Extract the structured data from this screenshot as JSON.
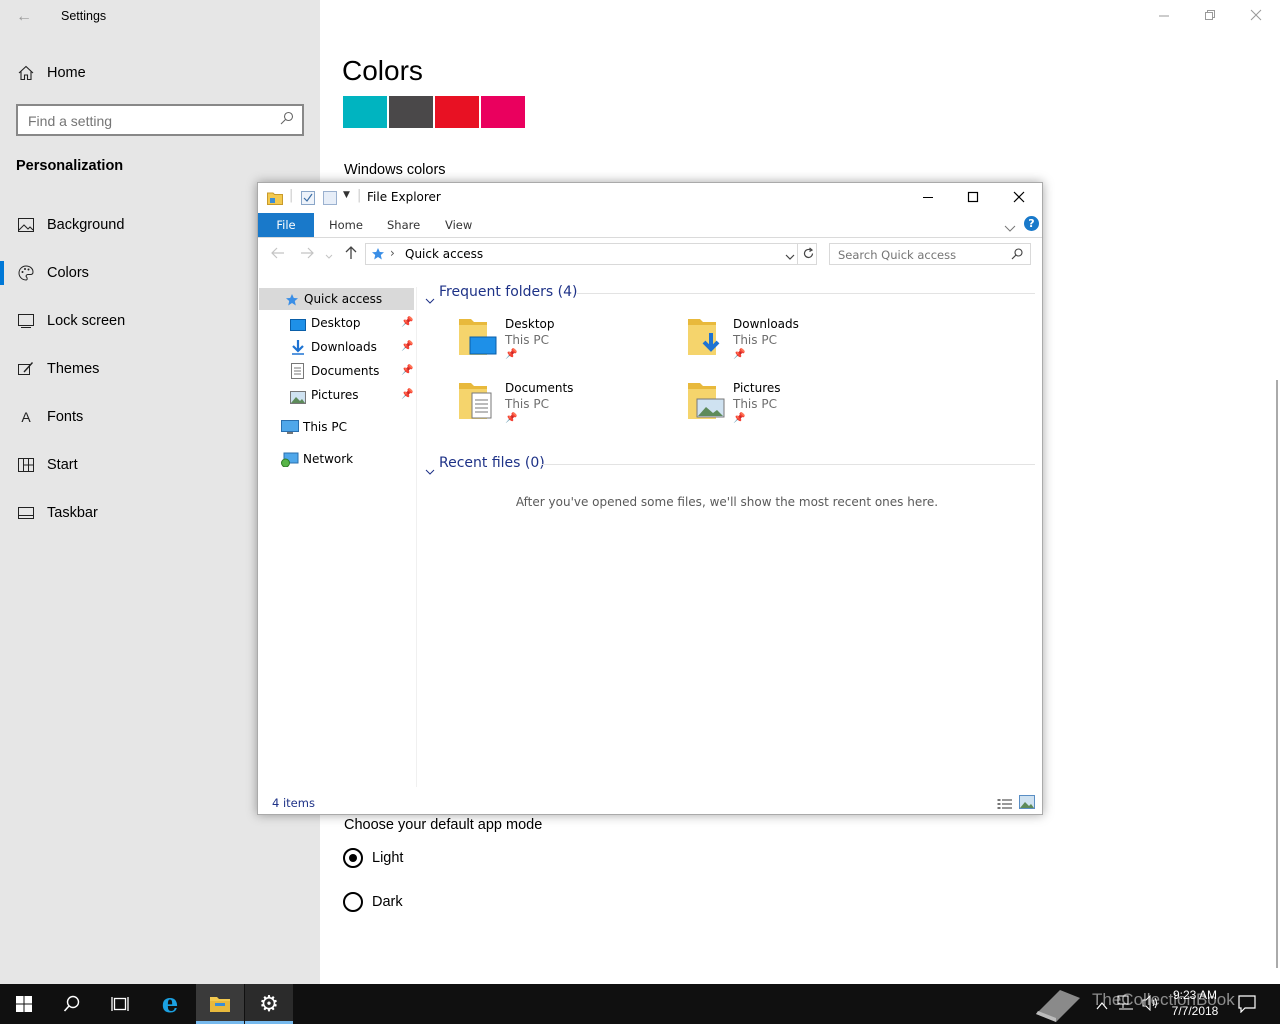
{
  "settings": {
    "window_title": "Settings",
    "home_label": "Home",
    "search_placeholder": "Find a setting",
    "section_title": "Personalization",
    "nav": [
      {
        "label": "Background"
      },
      {
        "label": "Colors"
      },
      {
        "label": "Lock screen"
      },
      {
        "label": "Themes"
      },
      {
        "label": "Fonts"
      },
      {
        "label": "Start"
      },
      {
        "label": "Taskbar"
      }
    ],
    "page_title": "Colors",
    "swatches": [
      "#00b4c0",
      "#4a4849",
      "#e81123",
      "#ea005e"
    ],
    "windows_colors_label": "Windows colors",
    "app_mode_label": "Choose your default app mode",
    "mode_options": [
      {
        "label": "Light",
        "selected": true
      },
      {
        "label": "Dark",
        "selected": false
      }
    ],
    "accent": "#0078d7"
  },
  "explorer": {
    "title": "File Explorer",
    "tabs": [
      "File",
      "Home",
      "Share",
      "View"
    ],
    "address": "Quick access",
    "search_placeholder": "Search Quick access",
    "nav_pane": {
      "quick_access": "Quick access",
      "pinned": [
        "Desktop",
        "Downloads",
        "Documents",
        "Pictures"
      ],
      "this_pc": "This PC",
      "network": "Network"
    },
    "frequent_header": "Frequent folders (4)",
    "folders": [
      {
        "name": "Desktop",
        "location": "This PC"
      },
      {
        "name": "Downloads",
        "location": "This PC"
      },
      {
        "name": "Documents",
        "location": "This PC"
      },
      {
        "name": "Pictures",
        "location": "This PC"
      }
    ],
    "recent_header": "Recent files (0)",
    "recent_empty": "After you've opened some files, we'll show the most recent ones here.",
    "status": "4 items"
  },
  "taskbar": {
    "time": "9:23 AM",
    "date": "7/7/2018",
    "watermark": "TheCollectionBook"
  }
}
